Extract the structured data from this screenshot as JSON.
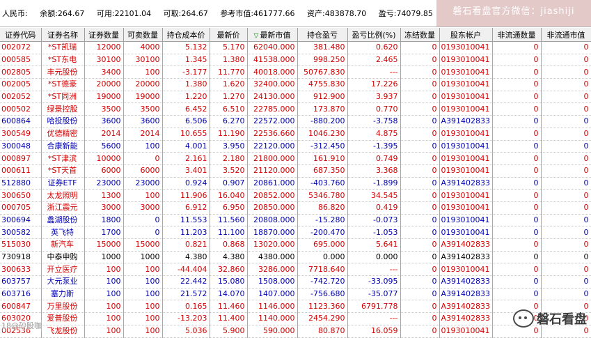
{
  "summary": {
    "currency": "人民币:",
    "balance": "余额:264.67",
    "available": "可用:22101.04",
    "withdrawable": "可取:264.67",
    "ref_market_value": "参考市值:461777.66",
    "assets": "资产:483878.70",
    "profit_loss": "盈亏:74079.85",
    "brand_banner": "磐石看盘官方微信：jiashiji"
  },
  "columns": [
    "证券代码",
    "证券名称",
    "证券数量",
    "可卖数量",
    "持仓成本价",
    "最新价",
    "最新市值",
    "持仓盈亏",
    "盈亏比例(%)",
    "冻结数量",
    "股东帐户",
    "非流通数量",
    "非流通市值"
  ],
  "sort_marker": "▽",
  "colors": {
    "red": "#d40000",
    "blue": "#0000b4",
    "black": "#000000"
  },
  "rows": [
    {
      "color": "red",
      "cells": [
        "002072",
        "*ST凯瑞",
        "12000",
        "4000",
        "5.132",
        "5.170",
        "62040.000",
        "381.480",
        "0.620",
        "0",
        "0193010041",
        "0",
        "0"
      ]
    },
    {
      "color": "red",
      "cells": [
        "000585",
        "*ST东电",
        "30100",
        "30100",
        "1.345",
        "1.380",
        "41538.000",
        "998.250",
        "2.465",
        "0",
        "0193010041",
        "0",
        "0"
      ]
    },
    {
      "color": "red",
      "cells": [
        "002805",
        "丰元股份",
        "3400",
        "100",
        "-3.177",
        "11.770",
        "40018.000",
        "50767.830",
        "---",
        "0",
        "0193010041",
        "0",
        "0"
      ]
    },
    {
      "color": "red",
      "cells": [
        "002005",
        "*ST德豪",
        "20000",
        "20000",
        "1.380",
        "1.620",
        "32400.000",
        "4755.830",
        "17.226",
        "0",
        "0193010041",
        "0",
        "0"
      ]
    },
    {
      "color": "red",
      "cells": [
        "002052",
        "*ST同洲",
        "19000",
        "19000",
        "1.220",
        "1.270",
        "24130.000",
        "912.900",
        "3.937",
        "0",
        "0193010041",
        "0",
        "0"
      ]
    },
    {
      "color": "red",
      "cells": [
        "000502",
        "绿景控股",
        "3500",
        "3500",
        "6.452",
        "6.510",
        "22785.000",
        "173.870",
        "0.770",
        "0",
        "0193010041",
        "0",
        "0"
      ]
    },
    {
      "color": "blue",
      "cells": [
        "600864",
        "哈投股份",
        "3600",
        "3600",
        "6.506",
        "6.270",
        "22572.000",
        "-880.200",
        "-3.758",
        "0",
        "A391402833",
        "0",
        "0"
      ]
    },
    {
      "color": "red",
      "cells": [
        "300549",
        "优德精密",
        "2014",
        "2014",
        "10.655",
        "11.190",
        "22536.660",
        "1046.230",
        "4.875",
        "0",
        "0193010041",
        "0",
        "0"
      ]
    },
    {
      "color": "blue",
      "cells": [
        "300048",
        "合康新能",
        "5600",
        "100",
        "4.001",
        "3.950",
        "22120.000",
        "-312.450",
        "-1.395",
        "0",
        "0193010041",
        "0",
        "0"
      ]
    },
    {
      "color": "red",
      "cells": [
        "000897",
        "*ST津滨",
        "10000",
        "0",
        "2.161",
        "2.180",
        "21800.000",
        "161.910",
        "0.749",
        "0",
        "0193010041",
        "0",
        "0"
      ]
    },
    {
      "color": "red",
      "cells": [
        "000611",
        "*ST天首",
        "6000",
        "6000",
        "3.401",
        "3.520",
        "21120.000",
        "687.350",
        "3.368",
        "0",
        "0193010041",
        "0",
        "0"
      ]
    },
    {
      "color": "blue",
      "cells": [
        "512880",
        "证券ETF",
        "23000",
        "23000",
        "0.924",
        "0.907",
        "20861.000",
        "-403.760",
        "-1.899",
        "0",
        "A391402833",
        "0",
        "0"
      ]
    },
    {
      "color": "red",
      "cells": [
        "300650",
        "太龙照明",
        "1300",
        "100",
        "11.906",
        "16.040",
        "20852.000",
        "5346.780",
        "34.545",
        "0",
        "0193010041",
        "0",
        "0"
      ]
    },
    {
      "color": "red",
      "cells": [
        "000705",
        "浙江震元",
        "3000",
        "3000",
        "6.912",
        "6.950",
        "20850.000",
        "86.820",
        "0.419",
        "0",
        "0193010041",
        "0",
        "0"
      ]
    },
    {
      "color": "blue",
      "cells": [
        "300694",
        "蠡湖股份",
        "1800",
        "0",
        "11.553",
        "11.560",
        "20808.000",
        "-15.280",
        "-0.073",
        "0",
        "0193010041",
        "0",
        "0"
      ]
    },
    {
      "color": "blue",
      "cells": [
        "300582",
        "英飞特",
        "1700",
        "0",
        "11.203",
        "11.100",
        "18870.000",
        "-200.470",
        "-1.053",
        "0",
        "0193010041",
        "0",
        "0"
      ]
    },
    {
      "color": "red",
      "cells": [
        "515030",
        "新汽车",
        "15000",
        "15000",
        "0.821",
        "0.868",
        "13020.000",
        "695.000",
        "5.641",
        "0",
        "A391402833",
        "0",
        "0"
      ]
    },
    {
      "color": "black",
      "cells": [
        "730918",
        "中泰申购",
        "1000",
        "1000",
        "4.380",
        "4.380",
        "4380.000",
        "0.000",
        "0.000",
        "0",
        "A391402833",
        "0",
        "0"
      ]
    },
    {
      "color": "red",
      "cells": [
        "300633",
        "开立医疗",
        "100",
        "100",
        "-44.404",
        "32.860",
        "3286.000",
        "7718.640",
        "---",
        "0",
        "0193010041",
        "0",
        "0"
      ]
    },
    {
      "color": "blue",
      "cells": [
        "603757",
        "大元泵业",
        "100",
        "100",
        "22.442",
        "15.080",
        "1508.000",
        "-742.720",
        "-33.095",
        "0",
        "A391402833",
        "0",
        "0"
      ]
    },
    {
      "color": "blue",
      "cells": [
        "603716",
        "塞力斯",
        "100",
        "100",
        "21.572",
        "14.070",
        "1407.000",
        "-756.680",
        "-35.077",
        "0",
        "A391402833",
        "0",
        "0"
      ]
    },
    {
      "color": "red",
      "cells": [
        "600847",
        "万里股份",
        "100",
        "100",
        "0.165",
        "11.460",
        "1146.000",
        "1123.360",
        "6791.778",
        "0",
        "A391402833",
        "0",
        "0"
      ]
    },
    {
      "color": "red",
      "cells": [
        "603020",
        "爱普股份",
        "100",
        "100",
        "-13.203",
        "11.400",
        "1140.000",
        "2454.290",
        "---",
        "0",
        "A391402833",
        "0",
        "0"
      ]
    },
    {
      "color": "red",
      "cells": [
        "002536",
        "飞龙股份",
        "100",
        "100",
        "5.036",
        "5.900",
        "590.000",
        "80.870",
        "16.059",
        "0",
        "0193010041",
        "0",
        "0"
      ]
    }
  ],
  "watermark": {
    "text": "磐石看盘",
    "icon": "wechat-icon",
    "corner_text": "18@砂股咖"
  }
}
